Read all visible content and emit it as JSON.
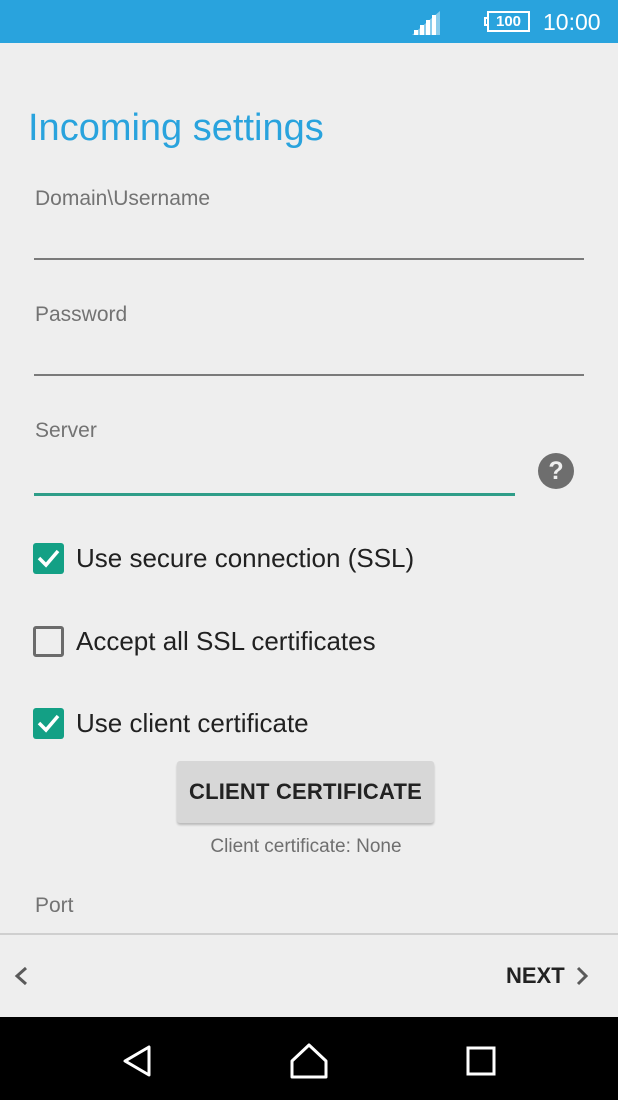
{
  "status_bar": {
    "battery_level": "100",
    "time": "10:00",
    "signal_icon": "signal-strength-icon",
    "battery_icon": "battery-icon",
    "color": "#29a3dd"
  },
  "screen": {
    "title": "Incoming settings",
    "accent_color": "#29a3dd",
    "focus_color": "#13a085"
  },
  "fields": {
    "username": {
      "label": "Domain\\Username",
      "value": ""
    },
    "password": {
      "label": "Password",
      "value": ""
    },
    "server": {
      "label": "Server",
      "value": "",
      "help_icon": "question-mark-icon",
      "help_glyph": "?"
    },
    "port": {
      "label": "Port"
    }
  },
  "checkboxes": [
    {
      "label": "Use secure connection (SSL)",
      "checked": true
    },
    {
      "label": "Accept all SSL certificates",
      "checked": false
    },
    {
      "label": "Use client certificate",
      "checked": true
    }
  ],
  "client_certificate": {
    "button_label": "CLIENT CERTIFICATE",
    "status": "Client certificate: None"
  },
  "bottom_bar": {
    "back_icon": "chevron-left-icon",
    "next_label": "NEXT",
    "next_icon": "chevron-right-icon"
  },
  "nav_bar": {
    "back_icon": "triangle-back-icon",
    "home_icon": "home-icon",
    "recents_icon": "square-recents-icon"
  }
}
